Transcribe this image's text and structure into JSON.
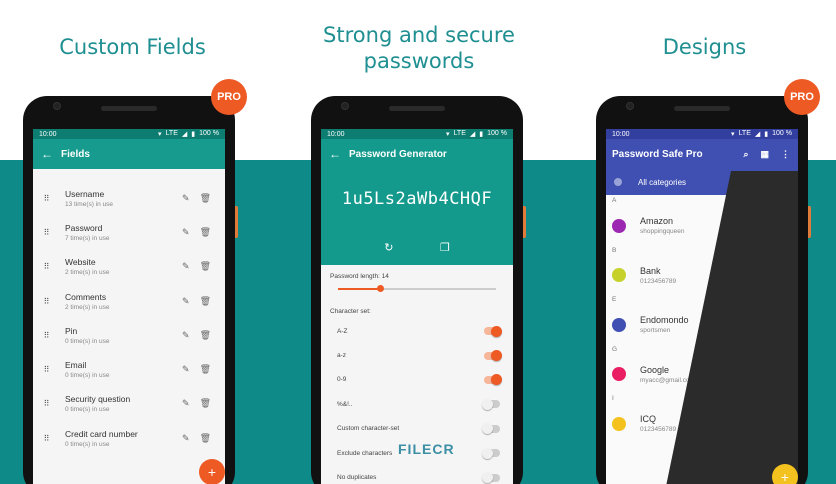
{
  "colors": {
    "teal_band": "#0e8a88",
    "caption": "#1f8f91",
    "fields_appbar": "#169b8e",
    "orange": "#ee5a24",
    "design_blue": "#3f4fb2",
    "fab_yellow": "#f4c21f"
  },
  "captions": {
    "left": "Custom Fields",
    "middle_line1": "Strong and secure",
    "middle_line2": "passwords",
    "right": "Designs"
  },
  "pro_badge": "PRO",
  "status": {
    "time": "10:00",
    "network": "LTE",
    "battery": "100 %"
  },
  "fields_screen": {
    "title": "Fields",
    "back_icon": "arrow-left-icon",
    "items": [
      {
        "name": "Username",
        "count": "13 time(s) in use"
      },
      {
        "name": "Password",
        "count": "7 time(s) in use"
      },
      {
        "name": "Website",
        "count": "2 time(s) in use"
      },
      {
        "name": "Comments",
        "count": "2 time(s) in use"
      },
      {
        "name": "Pin",
        "count": "0 time(s) in use"
      },
      {
        "name": "Email",
        "count": "0 time(s) in use"
      },
      {
        "name": "Security question",
        "count": "0 time(s) in use"
      },
      {
        "name": "Credit card number",
        "count": "0 time(s) in use"
      }
    ],
    "fab": "+"
  },
  "generator_screen": {
    "title": "Password Generator",
    "password": "1u5Ls2aWb4CHQF",
    "length_label": "Password length: 14",
    "length_fraction": 0.27,
    "charset_label": "Character set:",
    "options": [
      {
        "label": "A-Z",
        "on": true
      },
      {
        "label": "a-z",
        "on": true
      },
      {
        "label": "0-9",
        "on": true
      },
      {
        "label": "%&!..",
        "on": false
      },
      {
        "label": "Custom character-set",
        "on": false
      },
      {
        "label": "Exclude characters",
        "on": false
      },
      {
        "label": "No duplicates",
        "on": false
      }
    ]
  },
  "design_screen": {
    "title": "Password Safe Pro",
    "category": "All categories",
    "sections": [
      {
        "letter": "A",
        "entries": [
          {
            "name": "Amazon",
            "sub": "shoppingqueen",
            "color": "#9c27b0"
          }
        ]
      },
      {
        "letter": "B",
        "entries": [
          {
            "name": "Bank",
            "sub": "0123456789",
            "color": "#c6d22b"
          }
        ]
      },
      {
        "letter": "E",
        "entries": [
          {
            "name": "Endomondo",
            "sub": "sportsmen",
            "color": "#3f4fb2"
          }
        ]
      },
      {
        "letter": "G",
        "entries": [
          {
            "name": "Google",
            "sub": "myacc@gmail.com",
            "color": "#e91e63"
          }
        ]
      },
      {
        "letter": "I",
        "entries": [
          {
            "name": "ICQ",
            "sub": "0123456789",
            "color": "#f4c21f"
          }
        ]
      }
    ],
    "fab": "+"
  },
  "watermark": "FILECR"
}
